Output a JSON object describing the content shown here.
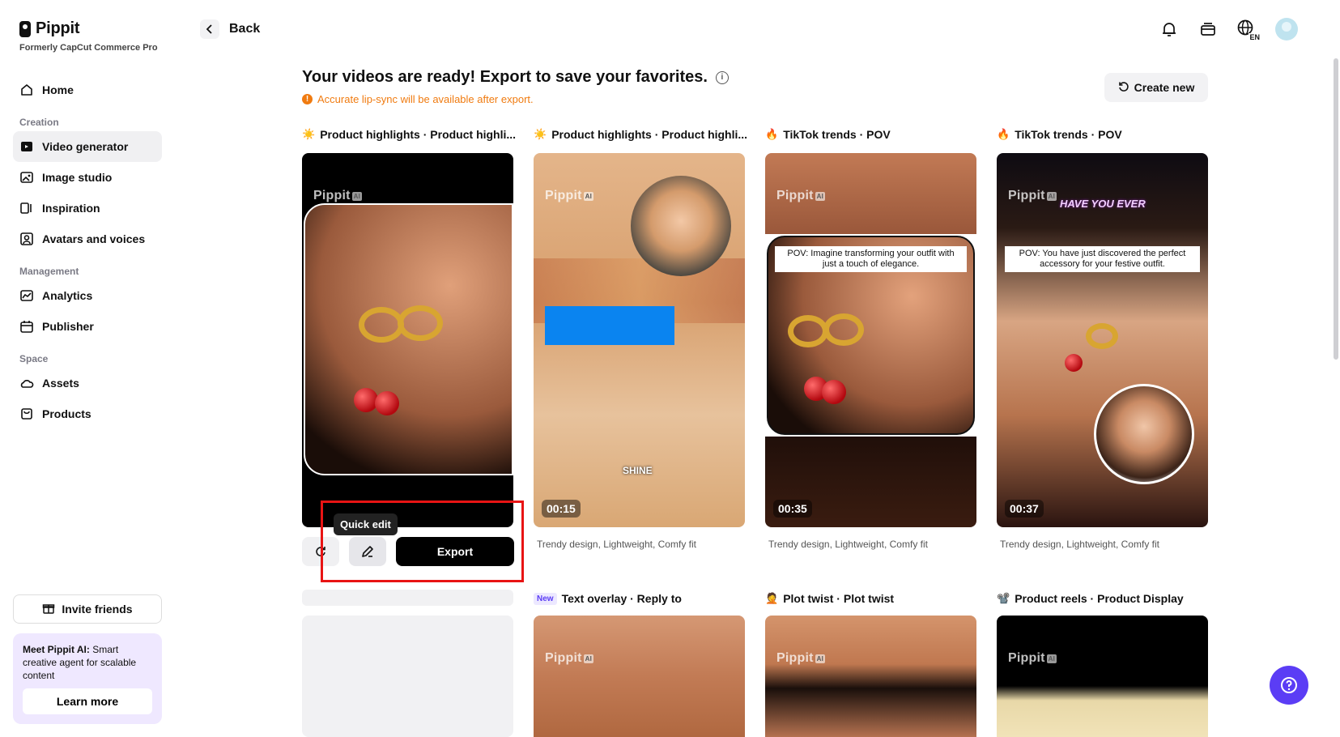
{
  "brand": {
    "name": "Pippit",
    "subtitle": "Formerly CapCut Commerce Pro"
  },
  "sidebar": {
    "home": "Home",
    "creation_label": "Creation",
    "creation_items": [
      "Video generator",
      "Image studio",
      "Inspiration",
      "Avatars and voices"
    ],
    "management_label": "Management",
    "management_items": [
      "Analytics",
      "Publisher"
    ],
    "space_label": "Space",
    "space_items": [
      "Assets",
      "Products"
    ],
    "active_item": "Video generator",
    "invite": "Invite friends",
    "promo": {
      "bold": "Meet Pippit AI:",
      "text": " Smart creative agent for scalable content",
      "button": "Learn more"
    }
  },
  "topbar": {
    "back": "Back",
    "language_badge": "EN"
  },
  "header": {
    "title": "Your videos are ready! Export to save your favorites.",
    "warning": "Accurate lip-sync will be available after export.",
    "create_new": "Create new"
  },
  "watermark": {
    "text": "Pippit",
    "badge": "AI"
  },
  "cards": [
    {
      "emoji": "☀️",
      "title": "Product highlights · Product highli...",
      "duration": "",
      "tags": ""
    },
    {
      "emoji": "☀️",
      "title": "Product highlights · Product highli...",
      "duration": "00:15",
      "tags": "Trendy design, Lightweight, Comfy fit",
      "overlay": "SHINE"
    },
    {
      "emoji": "🔥",
      "title": "TikTok trends · POV",
      "duration": "00:35",
      "tags": "Trendy design, Lightweight, Comfy fit",
      "caption": "POV: Imagine transforming your outfit with just a touch of elegance."
    },
    {
      "emoji": "🔥",
      "title": "TikTok trends · POV",
      "duration": "00:37",
      "tags": "Trendy design, Lightweight, Comfy fit",
      "caption": "POV: You have just discovered the perfect accessory for your festive outfit.",
      "overlay": "HAVE YOU EVER"
    }
  ],
  "row2": [
    {
      "badge": "New",
      "title": "Text overlay · Reply to"
    },
    {
      "emoji": "🤦",
      "title": "Plot twist · Plot twist"
    },
    {
      "emoji": "📽️",
      "title": "Product reels · Product Display"
    }
  ],
  "actions": {
    "tooltip": "Quick edit",
    "export": "Export"
  },
  "colors": {
    "accent": "#5b3df5",
    "warning": "#f07b10",
    "highlight": "#e81414"
  }
}
